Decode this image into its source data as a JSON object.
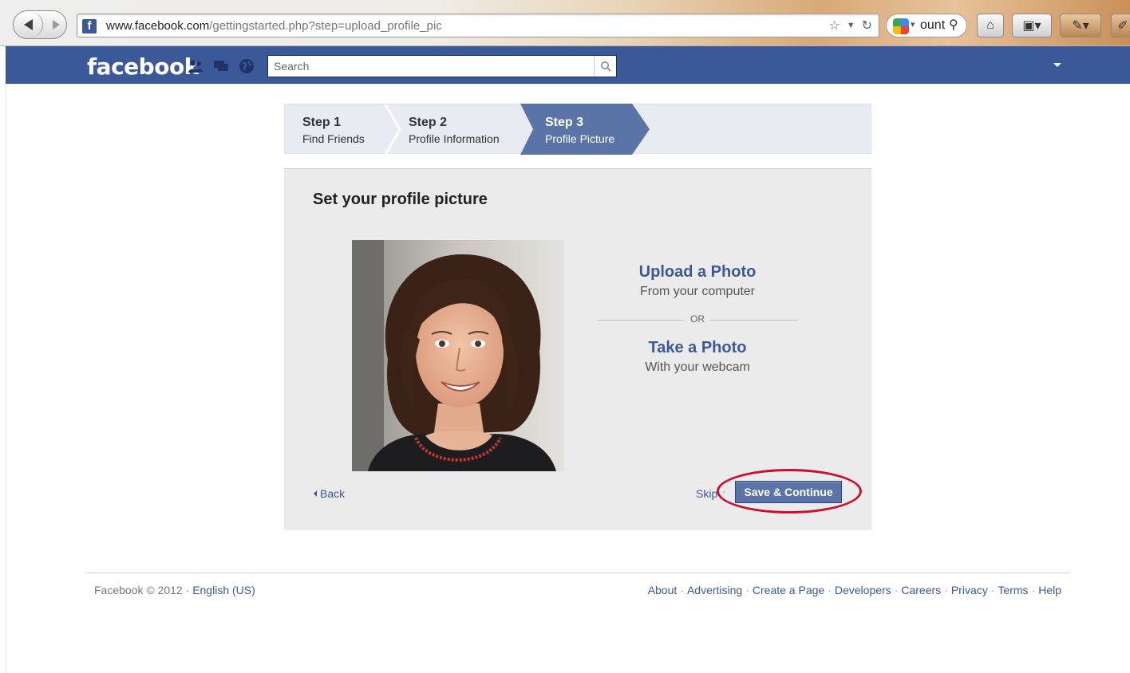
{
  "browser": {
    "url_domain": "www.facebook.com",
    "url_path": "/gettingstarted.php?step=upload_profile_pic",
    "search_text": "ount"
  },
  "header": {
    "logo": "facebook",
    "search_placeholder": "Search",
    "brand_color": "#3b5998"
  },
  "steps": [
    {
      "title": "Step 1",
      "subtitle": "Find Friends",
      "active": false
    },
    {
      "title": "Step 2",
      "subtitle": "Profile Information",
      "active": false
    },
    {
      "title": "Step 3",
      "subtitle": "Profile Picture",
      "active": true
    }
  ],
  "main": {
    "title": "Set your profile picture",
    "upload_link": "Upload a Photo",
    "upload_sub": "From your computer",
    "or_label": "OR",
    "take_link": "Take a Photo",
    "take_sub": "With your webcam",
    "back_label": "Back",
    "skip_label": "Skip",
    "save_label": "Save & Continue",
    "highlight_color": "#c8102e"
  },
  "footer": {
    "copyright": "Facebook © 2012",
    "language": "English (US)",
    "links": [
      "About",
      "Advertising",
      "Create a Page",
      "Developers",
      "Careers",
      "Privacy",
      "Terms",
      "Help"
    ]
  }
}
